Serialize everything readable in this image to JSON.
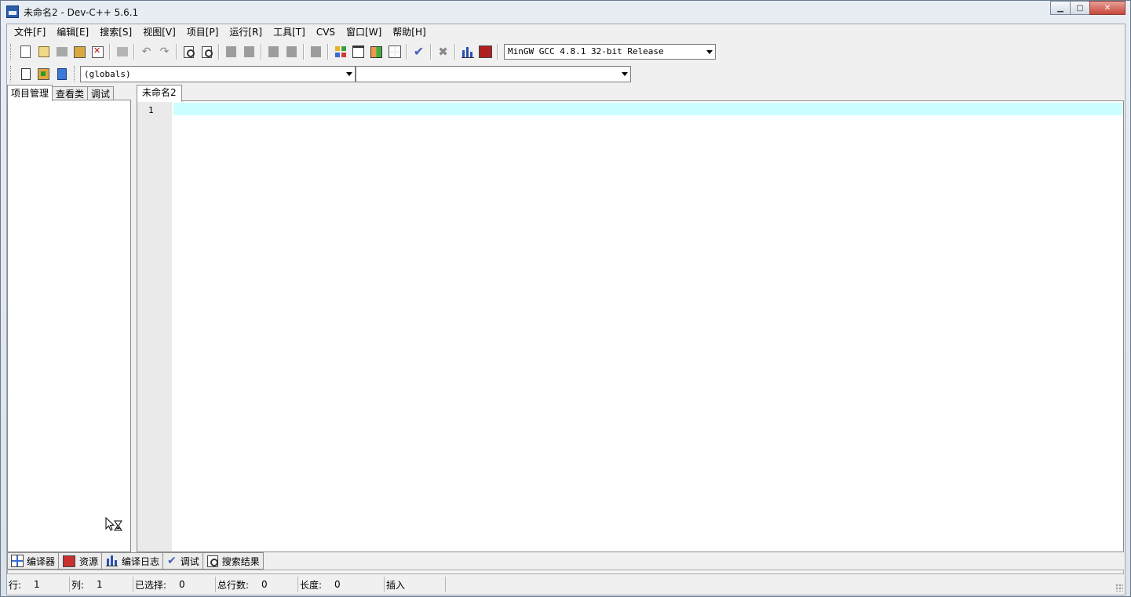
{
  "window": {
    "title": "未命名2 - Dev-C++ 5.6.1",
    "minimize": "▁",
    "maximize": "▢",
    "close": "✕"
  },
  "menu": [
    "文件[F]",
    "编辑[E]",
    "搜索[S]",
    "视图[V]",
    "项目[P]",
    "运行[R]",
    "工具[T]",
    "CVS",
    "窗口[W]",
    "帮助[H]"
  ],
  "toolbar": {
    "compiler_selected": "MinGW GCC 4.8.1 32-bit Release",
    "icons": [
      "new-file-icon",
      "open-file-icon",
      "save-icon",
      "save-all-icon",
      "close-file-icon",
      "print-icon",
      "undo-icon",
      "redo-icon",
      "find-icon",
      "replace-icon",
      "indent-icon",
      "unindent-icon",
      "toggle-bookmark-icon",
      "goto-bookmark-icon",
      "compile-icon",
      "run-icon",
      "compile-run-icon",
      "rebuild-icon",
      "syntax-check-icon",
      "stop-icon",
      "profile-icon",
      "delete-profile-icon"
    ]
  },
  "class_toolbar": {
    "scope_selected": "(globals)",
    "member_selected": ""
  },
  "left_panel": {
    "tabs": [
      "项目管理",
      "查看类",
      "调试"
    ],
    "active_tab": 0
  },
  "editor": {
    "tabs": [
      "未命名2"
    ],
    "line_numbers": [
      "1"
    ],
    "current_line_color": "#ccffff"
  },
  "bottom_tabs": [
    "编译器",
    "资源",
    "编译日志",
    "调试",
    "搜索结果"
  ],
  "status": {
    "row_label": "行:",
    "row_value": "1",
    "col_label": "列:",
    "col_value": "1",
    "sel_label": "已选择:",
    "sel_value": "0",
    "lines_label": "总行数:",
    "lines_value": "0",
    "len_label": "长度:",
    "len_value": "0",
    "mode": "插入"
  }
}
